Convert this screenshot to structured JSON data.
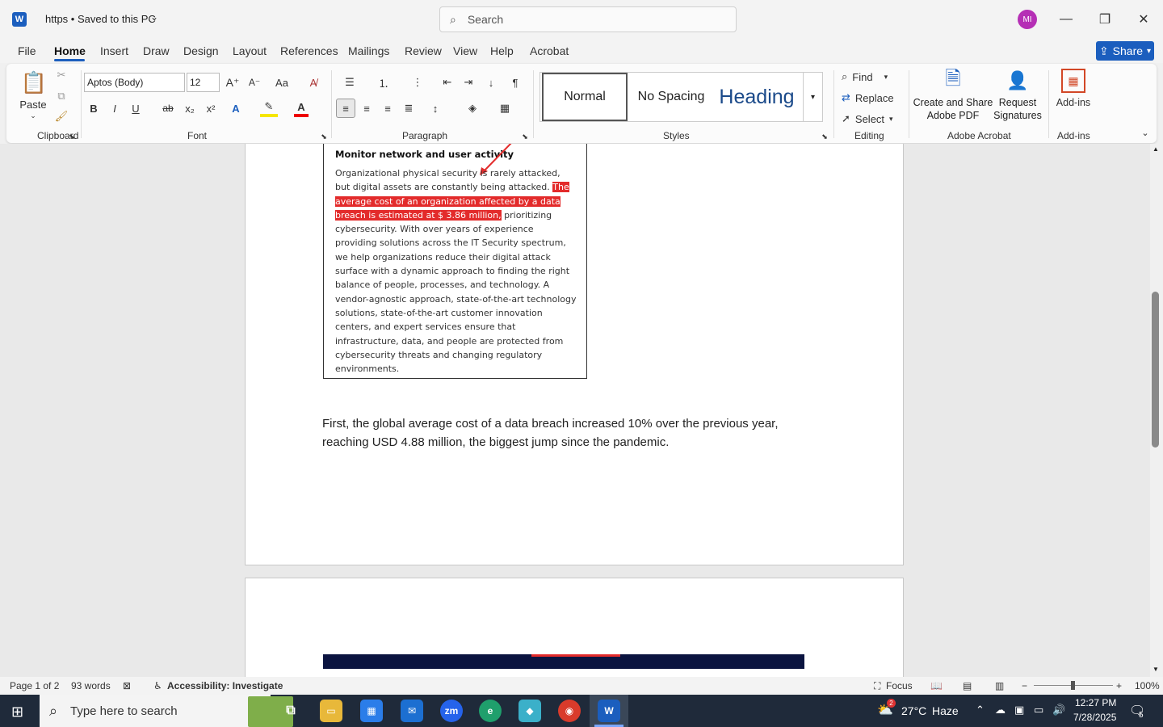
{
  "titlebar": {
    "app_icon": "word-icon",
    "doc_title": "https  •  Saved to this PC",
    "search_placeholder": "Search",
    "avatar_initials": "MI"
  },
  "menu": {
    "items": [
      "File",
      "Home",
      "Insert",
      "Draw",
      "Design",
      "Layout",
      "References",
      "Mailings",
      "Review",
      "View",
      "Help",
      "Acrobat"
    ],
    "active": "Home",
    "share_label": "Share"
  },
  "ribbon": {
    "clipboard": {
      "paste_label": "Paste",
      "group_label": "Clipboard"
    },
    "font": {
      "font_name": "Aptos (Body)",
      "font_size": "12",
      "group_label": "Font",
      "bold": "B",
      "italic": "I",
      "underline": "U",
      "strike": "ab",
      "case": "Aa"
    },
    "paragraph": {
      "group_label": "Paragraph"
    },
    "styles": {
      "normal": "Normal",
      "no_spacing": "No Spacing",
      "heading": "Heading",
      "group_label": "Styles"
    },
    "editing": {
      "find": "Find",
      "replace": "Replace",
      "select": "Select",
      "group_label": "Editing"
    },
    "acrobat": {
      "create_line1": "Create and Share",
      "create_line2": "Adobe PDF",
      "request_line1": "Request",
      "request_line2": "Signatures",
      "group_label": "Adobe Acrobat"
    },
    "addins": {
      "label": "Add-ins",
      "group_label": "Add-ins"
    }
  },
  "document": {
    "image_title": "Monitor network and user activity",
    "image_text_before": "Organizational physical security is rarely attacked, but digital assets are constantly being attacked. ",
    "image_text_highlight": "The average cost of an organization affected by a data breach is estimated at $ 3.86 million,",
    "image_text_after": " prioritizing cybersecurity. With over years of experience providing solutions across the IT Security spectrum, we help organizations reduce their digital attack surface with a dynamic approach to finding the right balance of people, processes, and technology. A vendor-agnostic approach, state-of-the-art technology solutions, state-of-the-art customer innovation centers, and expert services ensure that infrastructure, data, and people are protected from cybersecurity threats and changing regulatory environments.",
    "paragraph": "First, the global average cost of a data breach increased 10% over the previous year, reaching USD 4.88 million, the biggest jump since the pandemic."
  },
  "status": {
    "page": "Page 1 of 2",
    "words": "93 words",
    "accessibility": "Accessibility: Investigate",
    "focus": "Focus",
    "zoom": "100%"
  },
  "taskbar": {
    "search_placeholder": "Type here to search",
    "weather_temp": "27°C",
    "weather_desc": "Haze",
    "time": "12:27 PM",
    "date": "7/28/2025",
    "notif_count": "5",
    "weather_badge": "2"
  },
  "colors": {
    "accent": "#1b5ebe",
    "highlight": "#e32b2b",
    "taskbar": "#1f2a3a"
  }
}
